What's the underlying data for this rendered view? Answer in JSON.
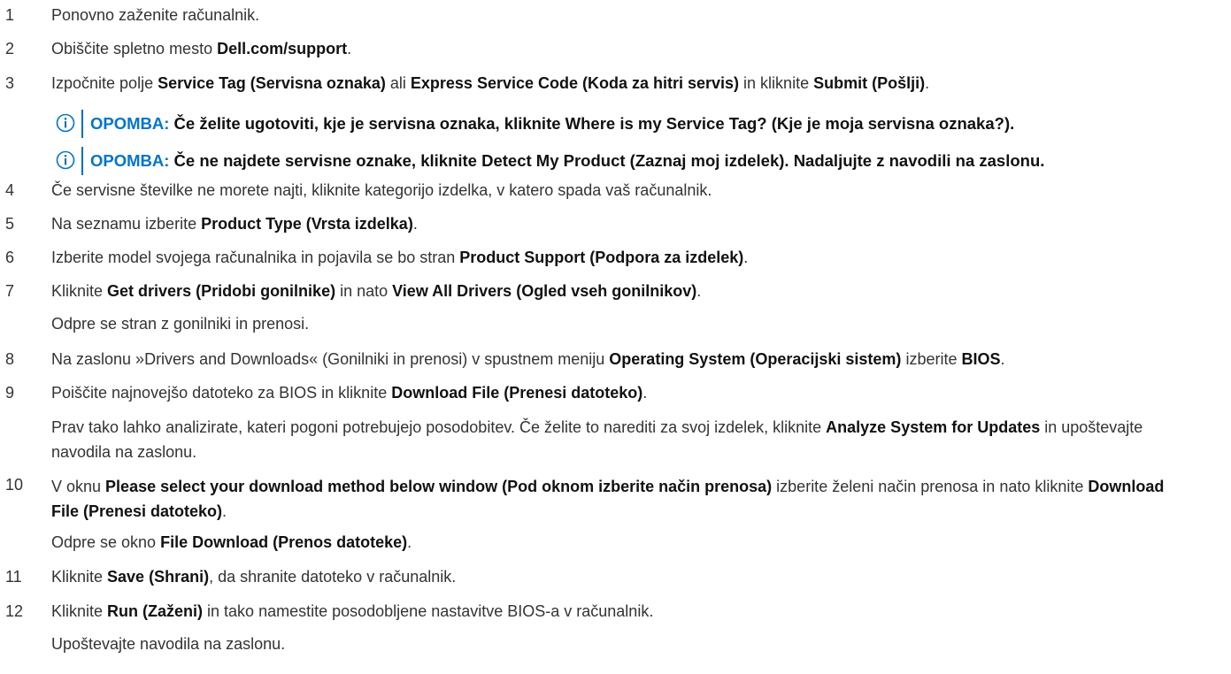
{
  "steps": [
    {
      "num": "1",
      "parts": [
        {
          "t": "Ponovno zaženite računalnik."
        }
      ]
    },
    {
      "num": "2",
      "parts": [
        {
          "t": "Obiščite spletno mesto "
        },
        {
          "t": "Dell.com/support",
          "b": true
        },
        {
          "t": "."
        }
      ]
    },
    {
      "num": "3",
      "parts": [
        {
          "t": "Izpočnite polje "
        },
        {
          "t": "Service Tag (Servisna oznaka)",
          "b": true
        },
        {
          "t": " ali "
        },
        {
          "t": "Express Service Code (Koda za hitri servis)",
          "b": true
        },
        {
          "t": " in kliknite "
        },
        {
          "t": "Submit (Pošlji)",
          "b": true
        },
        {
          "t": "."
        }
      ]
    },
    {
      "num": "4",
      "parts": [
        {
          "t": "Če servisne številke ne morete najti, kliknite kategorijo izdelka, v katero spada vaš računalnik."
        }
      ]
    },
    {
      "num": "5",
      "parts": [
        {
          "t": "Na seznamu izberite "
        },
        {
          "t": "Product Type (Vrsta izdelka)",
          "b": true
        },
        {
          "t": "."
        }
      ]
    },
    {
      "num": "6",
      "parts": [
        {
          "t": "Izberite model svojega računalnika in pojavila se bo stran "
        },
        {
          "t": "Product Support (Podpora za izdelek)",
          "b": true
        },
        {
          "t": "."
        }
      ]
    },
    {
      "num": "7",
      "parts": [
        {
          "t": "Kliknite "
        },
        {
          "t": "Get drivers (Pridobi gonilnike)",
          "b": true
        },
        {
          "t": " in nato "
        },
        {
          "t": "View All Drivers (Ogled vseh gonilnikov)",
          "b": true
        },
        {
          "t": "."
        }
      ]
    },
    {
      "num": "8",
      "parts": [
        {
          "t": "Na zaslonu »Drivers and Downloads« (Gonilniki in prenosi) v spustnem meniju "
        },
        {
          "t": "Operating System (Operacijski sistem)",
          "b": true
        },
        {
          "t": " izberite "
        },
        {
          "t": "BIOS",
          "b": true
        },
        {
          "t": "."
        }
      ]
    },
    {
      "num": "9",
      "parts": [
        {
          "t": "Poiščite najnovejšo datoteko za BIOS in kliknite "
        },
        {
          "t": "Download File (Prenesi datoteko)",
          "b": true
        },
        {
          "t": "."
        }
      ]
    },
    {
      "num": "10",
      "parts": [
        {
          "t": "V oknu "
        },
        {
          "t": "Please select your download method below window (Pod oknom izberite način prenosa)",
          "b": true
        },
        {
          "t": " izberite želeni način prenosa in nato kliknite "
        },
        {
          "t": "Download File (Prenesi datoteko)",
          "b": true
        },
        {
          "t": "."
        }
      ]
    },
    {
      "num": "11",
      "parts": [
        {
          "t": "Kliknite "
        },
        {
          "t": "Save (Shrani)",
          "b": true
        },
        {
          "t": ", da shranite datoteko v računalnik."
        }
      ]
    },
    {
      "num": "12",
      "parts": [
        {
          "t": "Kliknite "
        },
        {
          "t": "Run (Zaženi)",
          "b": true
        },
        {
          "t": " in tako namestite posodobljene nastavitve BIOS-a v računalnik."
        }
      ]
    }
  ],
  "notes": [
    {
      "label": "OPOMBA:",
      "text": " Če želite ugotoviti, kje je servisna oznaka, kliknite Where is my Service Tag? (Kje je moja servisna oznaka?)."
    },
    {
      "label": "OPOMBA:",
      "text": " Če ne najdete servisne oznake, kliknite Detect My Product (Zaznaj moj izdelek). Nadaljujte z navodili na zaslonu."
    }
  ],
  "continuations": {
    "step7": [
      {
        "t": "Odpre se stran z gonilniki in prenosi."
      }
    ],
    "step9": [
      {
        "t": "Prav tako lahko analizirate, kateri pogoni potrebujejo posodobitev. Če želite to narediti za svoj izdelek, kliknite "
      },
      {
        "t": "Analyze System for Updates",
        "b": true
      },
      {
        "t": " in upoštevajte navodila na zaslonu."
      }
    ],
    "step10": [
      {
        "t": "Odpre se okno "
      },
      {
        "t": "File Download (Prenos datoteke)",
        "b": true
      },
      {
        "t": "."
      }
    ],
    "step12": [
      {
        "t": "Upoštevajte navodila na zaslonu."
      }
    ]
  },
  "colors": {
    "note_accent": "#0076ce",
    "text": "#333333"
  },
  "icons": {
    "note": "info-circle-icon"
  }
}
